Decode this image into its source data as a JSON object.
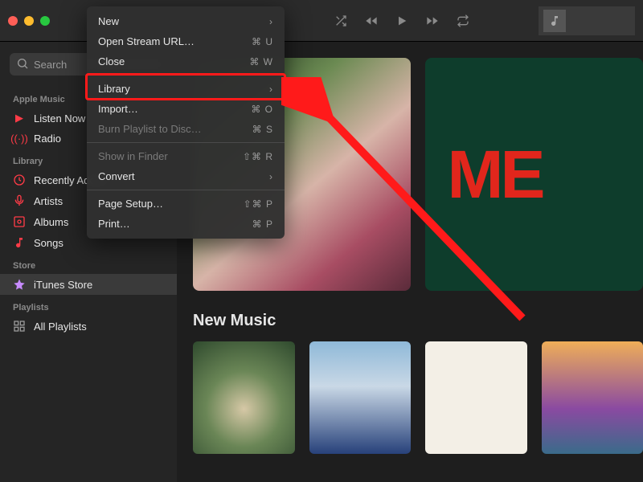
{
  "search": {
    "placeholder": "Search"
  },
  "sidebar": {
    "sections": {
      "appleMusic": {
        "title": "Apple Music",
        "items": [
          "Listen Now",
          "Radio"
        ]
      },
      "library": {
        "title": "Library",
        "items": [
          "Recently Added",
          "Artists",
          "Albums",
          "Songs"
        ]
      },
      "store": {
        "title": "Store",
        "items": [
          "iTunes Store"
        ]
      },
      "playlists": {
        "title": "Playlists",
        "items": [
          "All Playlists"
        ]
      }
    }
  },
  "menu": {
    "items": [
      {
        "label": "New",
        "shortcut": "",
        "submenu": true,
        "disabled": false
      },
      {
        "label": "Open Stream URL…",
        "shortcut": "⌘ U",
        "submenu": false,
        "disabled": false
      },
      {
        "label": "Close",
        "shortcut": "⌘ W",
        "submenu": false,
        "disabled": false
      },
      {
        "label": "Library",
        "shortcut": "",
        "submenu": true,
        "disabled": false,
        "highlight": true
      },
      {
        "label": "Import…",
        "shortcut": "⌘ O",
        "submenu": false,
        "disabled": false
      },
      {
        "label": "Burn Playlist to Disc…",
        "shortcut": "⌘ S",
        "submenu": false,
        "disabled": true
      },
      {
        "label": "Show in Finder",
        "shortcut": "⇧⌘ R",
        "submenu": false,
        "disabled": true
      },
      {
        "label": "Convert",
        "shortcut": "",
        "submenu": true,
        "disabled": false
      },
      {
        "label": "Page Setup…",
        "shortcut": "⇧⌘ P",
        "submenu": false,
        "disabled": false
      },
      {
        "label": "Print…",
        "shortcut": "⌘ P",
        "submenu": false,
        "disabled": false
      }
    ]
  },
  "main": {
    "heroText": "ME",
    "sectionTitle": "New Music"
  }
}
